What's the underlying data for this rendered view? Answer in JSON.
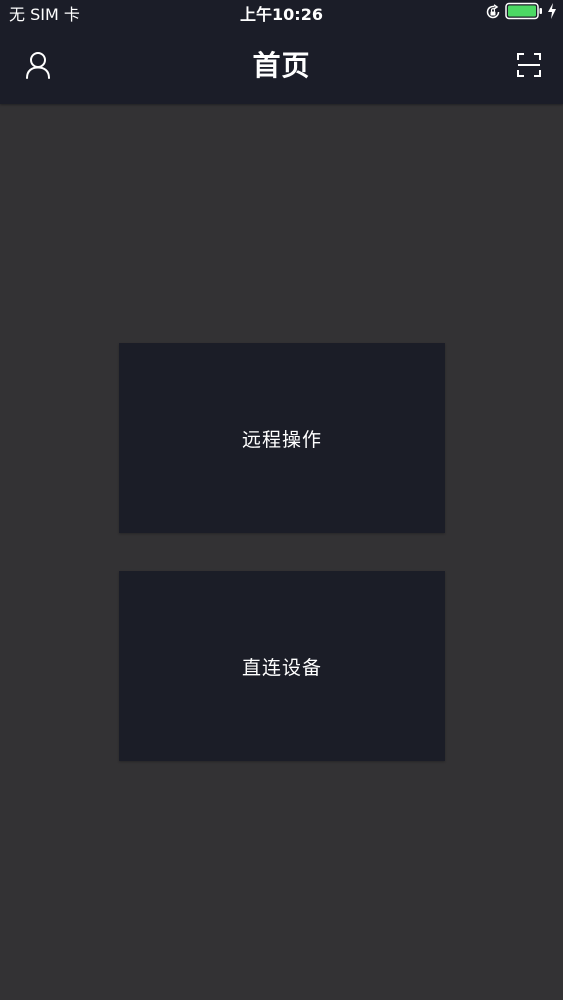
{
  "status_bar": {
    "carrier": "无 SIM 卡",
    "time": "上午10:26",
    "battery_color": "#4cd964"
  },
  "nav": {
    "title": "首页",
    "left_icon": "user-icon",
    "right_icon": "scan-icon"
  },
  "menu": {
    "remote_operation": "远程操作",
    "direct_device": "直连设备"
  },
  "colors": {
    "background": "#333234",
    "bar": "#1b1d28",
    "card": "#1b1d27"
  }
}
